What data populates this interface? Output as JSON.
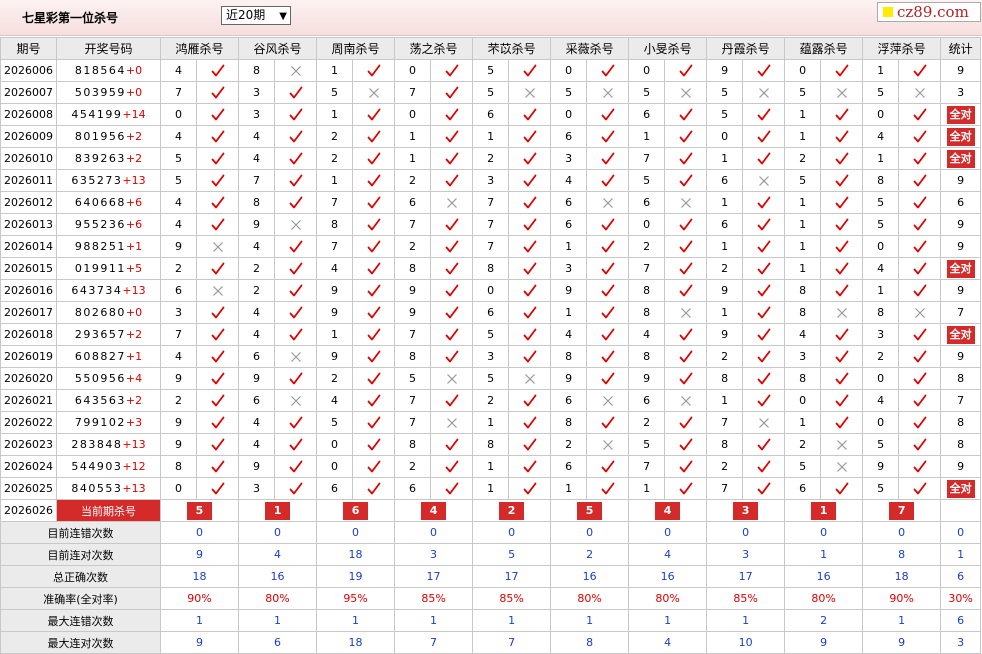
{
  "header": {
    "title": "七星彩第一位杀号",
    "range_select": "近20期",
    "logo": "cz89.com",
    "logo_color": "#b22222"
  },
  "columns": {
    "period": "期号",
    "code": "开奖号码",
    "experts": [
      "鸿雁杀号",
      "谷风杀号",
      "周南杀号",
      "荡之杀号",
      "芣苡杀号",
      "采薇杀号",
      "小旻杀号",
      "丹霞杀号",
      "蕴露杀号",
      "浮萍杀号"
    ],
    "stats": "统计"
  },
  "rows": [
    {
      "period": "2026006",
      "digits": "818564",
      "plus": "+0",
      "kills": [
        4,
        8,
        1,
        0,
        5,
        0,
        0,
        9,
        0,
        1
      ],
      "ok": [
        1,
        0,
        1,
        1,
        1,
        1,
        1,
        1,
        1,
        1
      ],
      "stat": "9"
    },
    {
      "period": "2026007",
      "digits": "503959",
      "plus": "+0",
      "kills": [
        7,
        3,
        5,
        7,
        5,
        5,
        5,
        5,
        5,
        5
      ],
      "ok": [
        1,
        1,
        0,
        1,
        0,
        0,
        0,
        0,
        0,
        0
      ],
      "stat": "3"
    },
    {
      "period": "2026008",
      "digits": "454199",
      "plus": "+14",
      "kills": [
        0,
        3,
        1,
        0,
        6,
        0,
        6,
        5,
        1,
        0
      ],
      "ok": [
        1,
        1,
        1,
        1,
        1,
        1,
        1,
        1,
        1,
        1
      ],
      "stat": "全对"
    },
    {
      "period": "2026009",
      "digits": "801956",
      "plus": "+2",
      "kills": [
        4,
        4,
        2,
        1,
        1,
        6,
        1,
        0,
        1,
        4
      ],
      "ok": [
        1,
        1,
        1,
        1,
        1,
        1,
        1,
        1,
        1,
        1
      ],
      "stat": "全对"
    },
    {
      "period": "2026010",
      "digits": "839263",
      "plus": "+2",
      "kills": [
        5,
        4,
        2,
        1,
        2,
        3,
        7,
        1,
        2,
        1
      ],
      "ok": [
        1,
        1,
        1,
        1,
        1,
        1,
        1,
        1,
        1,
        1
      ],
      "stat": "全对"
    },
    {
      "period": "2026011",
      "digits": "635273",
      "plus": "+13",
      "kills": [
        5,
        7,
        1,
        2,
        3,
        4,
        5,
        6,
        5,
        8
      ],
      "ok": [
        1,
        1,
        1,
        1,
        1,
        1,
        1,
        0,
        1,
        1
      ],
      "stat": "9"
    },
    {
      "period": "2026012",
      "digits": "640668",
      "plus": "+6",
      "kills": [
        4,
        8,
        7,
        6,
        7,
        6,
        6,
        1,
        1,
        5
      ],
      "ok": [
        1,
        1,
        1,
        0,
        1,
        0,
        0,
        1,
        1,
        1
      ],
      "stat": "6"
    },
    {
      "period": "2026013",
      "digits": "955236",
      "plus": "+6",
      "kills": [
        4,
        9,
        8,
        7,
        7,
        6,
        0,
        6,
        1,
        5
      ],
      "ok": [
        1,
        0,
        1,
        1,
        1,
        1,
        1,
        1,
        1,
        1
      ],
      "stat": "9"
    },
    {
      "period": "2026014",
      "digits": "988251",
      "plus": "+1",
      "kills": [
        9,
        4,
        7,
        2,
        7,
        1,
        2,
        1,
        1,
        0
      ],
      "ok": [
        0,
        1,
        1,
        1,
        1,
        1,
        1,
        1,
        1,
        1
      ],
      "stat": "9"
    },
    {
      "period": "2026015",
      "digits": "019911",
      "plus": "+5",
      "kills": [
        2,
        2,
        4,
        8,
        8,
        3,
        7,
        2,
        1,
        4
      ],
      "ok": [
        1,
        1,
        1,
        1,
        1,
        1,
        1,
        1,
        1,
        1
      ],
      "stat": "全对"
    },
    {
      "period": "2026016",
      "digits": "643734",
      "plus": "+13",
      "kills": [
        6,
        2,
        9,
        9,
        0,
        9,
        8,
        9,
        8,
        1
      ],
      "ok": [
        0,
        1,
        1,
        1,
        1,
        1,
        1,
        1,
        1,
        1
      ],
      "stat": "9"
    },
    {
      "period": "2026017",
      "digits": "802680",
      "plus": "+0",
      "kills": [
        3,
        4,
        9,
        9,
        6,
        1,
        8,
        1,
        8,
        8
      ],
      "ok": [
        1,
        1,
        1,
        1,
        1,
        1,
        0,
        1,
        0,
        0
      ],
      "stat": "7"
    },
    {
      "period": "2026018",
      "digits": "293657",
      "plus": "+2",
      "kills": [
        7,
        4,
        1,
        7,
        5,
        4,
        4,
        9,
        4,
        3
      ],
      "ok": [
        1,
        1,
        1,
        1,
        1,
        1,
        1,
        1,
        1,
        1
      ],
      "stat": "全对"
    },
    {
      "period": "2026019",
      "digits": "608827",
      "plus": "+1",
      "kills": [
        4,
        6,
        9,
        8,
        3,
        8,
        8,
        2,
        3,
        2
      ],
      "ok": [
        1,
        0,
        1,
        1,
        1,
        1,
        1,
        1,
        1,
        1
      ],
      "stat": "9"
    },
    {
      "period": "2026020",
      "digits": "550956",
      "plus": "+4",
      "kills": [
        9,
        9,
        2,
        5,
        5,
        9,
        9,
        8,
        8,
        0
      ],
      "ok": [
        1,
        1,
        1,
        0,
        0,
        1,
        1,
        1,
        1,
        1
      ],
      "stat": "8"
    },
    {
      "period": "2026021",
      "digits": "643563",
      "plus": "+2",
      "kills": [
        2,
        6,
        4,
        7,
        2,
        6,
        6,
        1,
        0,
        4
      ],
      "ok": [
        1,
        0,
        1,
        1,
        1,
        0,
        0,
        1,
        1,
        1
      ],
      "stat": "7"
    },
    {
      "period": "2026022",
      "digits": "799102",
      "plus": "+3",
      "kills": [
        9,
        4,
        5,
        7,
        1,
        8,
        2,
        7,
        1,
        0
      ],
      "ok": [
        1,
        1,
        1,
        0,
        1,
        1,
        1,
        0,
        1,
        1
      ],
      "stat": "8"
    },
    {
      "period": "2026023",
      "digits": "283848",
      "plus": "+13",
      "kills": [
        9,
        4,
        0,
        8,
        8,
        2,
        5,
        8,
        2,
        5
      ],
      "ok": [
        1,
        1,
        1,
        1,
        1,
        0,
        1,
        1,
        0,
        1
      ],
      "stat": "8"
    },
    {
      "period": "2026024",
      "digits": "544903",
      "plus": "+12",
      "kills": [
        8,
        9,
        0,
        2,
        1,
        6,
        7,
        2,
        5,
        9
      ],
      "ok": [
        1,
        1,
        1,
        1,
        1,
        1,
        1,
        1,
        0,
        1
      ],
      "stat": "9"
    },
    {
      "period": "2026025",
      "digits": "840553",
      "plus": "+13",
      "kills": [
        0,
        3,
        6,
        6,
        1,
        1,
        1,
        7,
        6,
        5
      ],
      "ok": [
        1,
        1,
        1,
        1,
        1,
        1,
        1,
        1,
        1,
        1
      ],
      "stat": "全对"
    }
  ],
  "current": {
    "period": "2026026",
    "label": "当前期杀号",
    "kills": [
      5,
      1,
      6,
      4,
      2,
      5,
      4,
      3,
      1,
      7
    ]
  },
  "summary": [
    {
      "label": "目前连错次数",
      "values": [
        "0",
        "0",
        "0",
        "0",
        "0",
        "0",
        "0",
        "0",
        "0",
        "0"
      ],
      "total": "0",
      "red": false
    },
    {
      "label": "目前连对次数",
      "values": [
        "9",
        "4",
        "18",
        "3",
        "5",
        "2",
        "4",
        "3",
        "1",
        "8"
      ],
      "total": "1",
      "red": false
    },
    {
      "label": "总正确次数",
      "values": [
        "18",
        "16",
        "19",
        "17",
        "17",
        "16",
        "16",
        "17",
        "16",
        "18"
      ],
      "total": "6",
      "red": false
    },
    {
      "label": "准确率(全对率)",
      "values": [
        "90%",
        "80%",
        "95%",
        "85%",
        "85%",
        "80%",
        "80%",
        "85%",
        "80%",
        "90%"
      ],
      "total": "30%",
      "red": true
    },
    {
      "label": "最大连错次数",
      "values": [
        "1",
        "1",
        "1",
        "1",
        "1",
        "1",
        "1",
        "1",
        "2",
        "1"
      ],
      "total": "6",
      "red": false
    },
    {
      "label": "最大连对次数",
      "values": [
        "9",
        "6",
        "18",
        "7",
        "7",
        "8",
        "4",
        "10",
        "9",
        "9"
      ],
      "total": "3",
      "red": false
    }
  ],
  "colors": {
    "accent_red": "#d42a2a",
    "stat_blue": "#1a3fc4",
    "tick_red": "#e00000",
    "cross_gray": "#999999"
  }
}
